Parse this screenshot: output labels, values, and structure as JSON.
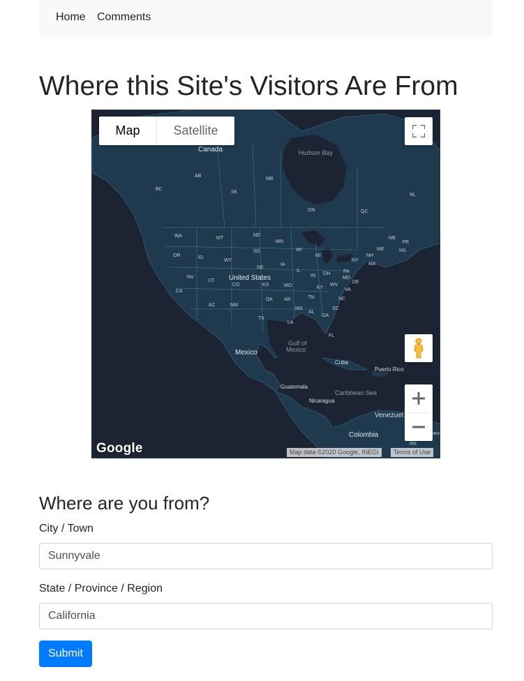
{
  "nav": {
    "items": [
      "Home",
      "Comments"
    ]
  },
  "page": {
    "title": "Where this Site's Visitors Are From"
  },
  "map": {
    "type_controls": {
      "map": "Map",
      "satellite": "Satellite"
    },
    "attribution": "Map data ©2020 Google, INEGI",
    "terms": "Terms of Use",
    "logo": "Google",
    "labels": {
      "canada": "Canada",
      "hudson_bay": "Hudson Bay",
      "united_states": "United States",
      "mexico": "Mexico",
      "gulf": "Gulf of",
      "gulf2": "Mexico",
      "cuba": "Cuba",
      "puerto_rico": "Puerto Rico",
      "caribbean": "Caribbean Sea",
      "guatemala": "Guatemala",
      "nicaragua": "Nicaragua",
      "venezuela": "Venezuel",
      "colombia": "Colombia",
      "ab": "AB",
      "bc": "BC",
      "sk": "SK",
      "mb": "MB",
      "on": "ON",
      "qc": "QC",
      "nl": "NL",
      "nb": "NB",
      "pe": "PE",
      "ns": "NS",
      "wa": "WA",
      "mt": "MT",
      "nd": "ND",
      "mn": "MN",
      "or": "OR",
      "id": "ID",
      "wy": "WY",
      "sd": "SD",
      "wi": "WI",
      "mi": "MI",
      "ny": "NY",
      "me": "ME",
      "nh": "NH",
      "ma": "MA",
      "nv": "NV",
      "ut": "UT",
      "ne": "NE",
      "ia": "IA",
      "il": "IL",
      "oh": "OH",
      "pa": "PA",
      "co": "CO",
      "ks": "KS",
      "mo": "MO",
      "in": "IN",
      "wv": "WV",
      "md": "MD",
      "de": "DE",
      "va": "VA",
      "ca": "CA",
      "ky": "KY",
      "az": "AZ",
      "nm": "NM",
      "ok": "OK",
      "ar": "AR",
      "tn": "TN",
      "nc": "NC",
      "sc": "SC",
      "ms": "MS",
      "al": "AL",
      "ga": "GA",
      "tx": "TX",
      "la": "LA",
      "fl": "FL",
      "rr": "RR",
      "ana": "ana"
    }
  },
  "form": {
    "title": "Where are you from?",
    "city_label": "City / Town",
    "city_value": "Sunnyvale",
    "state_label": "State / Province / Region",
    "state_value": "California",
    "submit": "Submit"
  }
}
